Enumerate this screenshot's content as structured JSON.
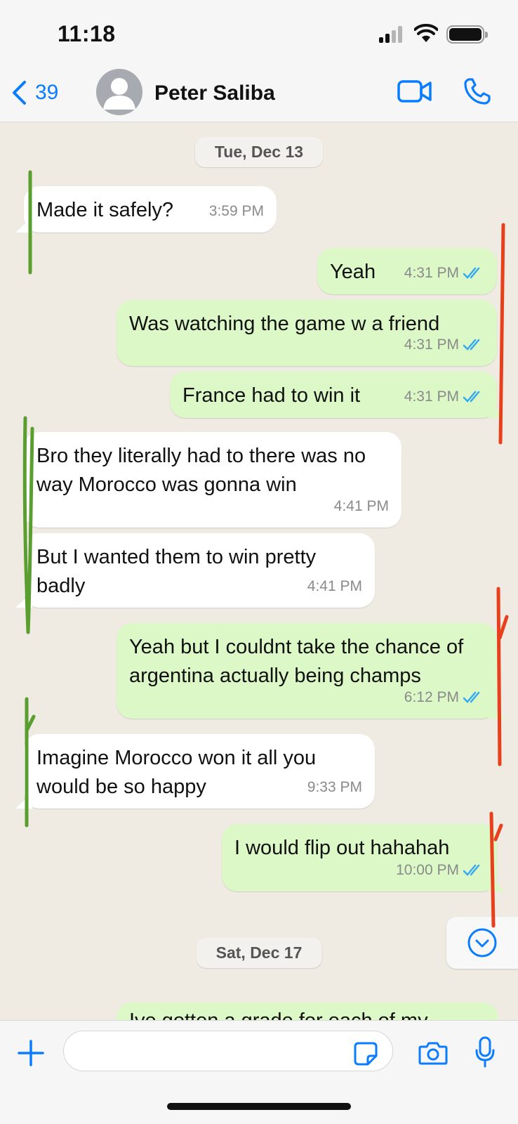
{
  "status_bar": {
    "time": "11:18"
  },
  "header": {
    "back_count": "39",
    "contact_name": "Peter Saliba"
  },
  "dates": {
    "first": "Tue, Dec 13",
    "second": "Sat, Dec 17"
  },
  "messages": [
    {
      "dir": "in",
      "text": "Made it safely?",
      "time": "3:59 PM"
    },
    {
      "dir": "out",
      "text": "Yeah",
      "time": "4:31 PM",
      "read": true
    },
    {
      "dir": "out",
      "text": "Was watching the game w a friend",
      "time": "4:31 PM",
      "read": true
    },
    {
      "dir": "out",
      "text": "France had to win it",
      "time": "4:31 PM",
      "read": true
    },
    {
      "dir": "in",
      "text": "Bro they literally had to there was no way Morocco was gonna win",
      "time": "4:41 PM"
    },
    {
      "dir": "in",
      "text": "But I wanted them to win pretty badly",
      "time": "4:41 PM"
    },
    {
      "dir": "out",
      "text": "Yeah but I couldnt take the chance of argentina actually being champs",
      "time": "6:12 PM",
      "read": true
    },
    {
      "dir": "in",
      "text": "Imagine Morocco won it all you would be so happy",
      "time": "9:33 PM"
    },
    {
      "dir": "out",
      "text": "I would flip out hahahah",
      "time": "10:00 PM",
      "read": true
    }
  ],
  "partial_message": {
    "text": "Ive gotten a grade for each of my"
  },
  "composer": {
    "placeholder": ""
  },
  "colors": {
    "accent": "#0a7cff",
    "out_bubble": "#dbf8c6",
    "in_bubble": "#ffffff",
    "green_mark": "#5a9e2f",
    "red_mark": "#e8401c"
  },
  "icons": [
    "back-chevron-icon",
    "avatar-icon",
    "video-call-icon",
    "phone-icon",
    "read-ticks-icon",
    "scroll-down-icon",
    "plus-icon",
    "sticker-icon",
    "camera-icon",
    "mic-icon"
  ]
}
